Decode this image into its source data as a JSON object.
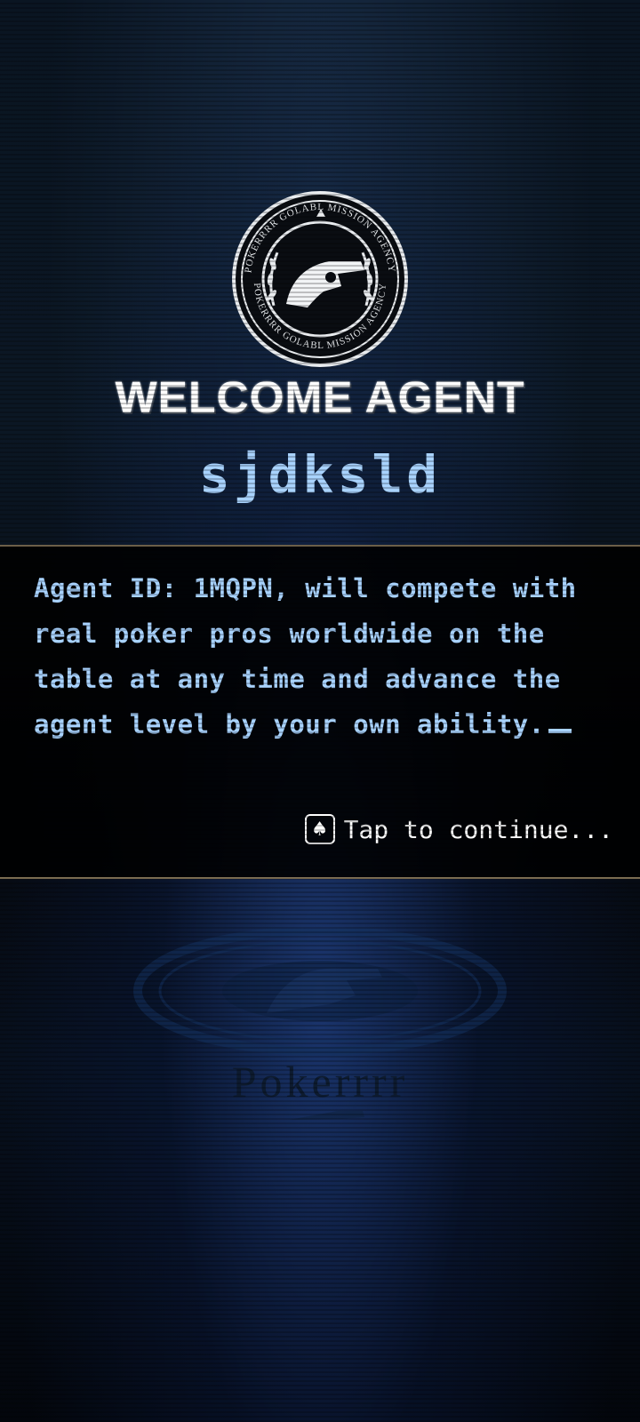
{
  "emblem": {
    "ring_text_top": "POKERRRR GOLABL MISSION AGENCY",
    "ring_text_bottom": "POKERRRR GOLABL MISSION AGENCY"
  },
  "header": {
    "title": "WELCOME  AGENT",
    "username": "sjdksld"
  },
  "dialog": {
    "message": "Agent ID: 1MQPN, will compete with real poker pros worldwide on the table at any time and advance the agent level by your own ability.",
    "continue_label": "Tap to continue...",
    "continue_icon": "spade-icon"
  },
  "floor": {
    "brand_word": "Pokerrrr"
  },
  "colors": {
    "accent_text": "#a9d3ff",
    "panel_border": "#8a7a5c",
    "panel_bg": "#000000"
  }
}
